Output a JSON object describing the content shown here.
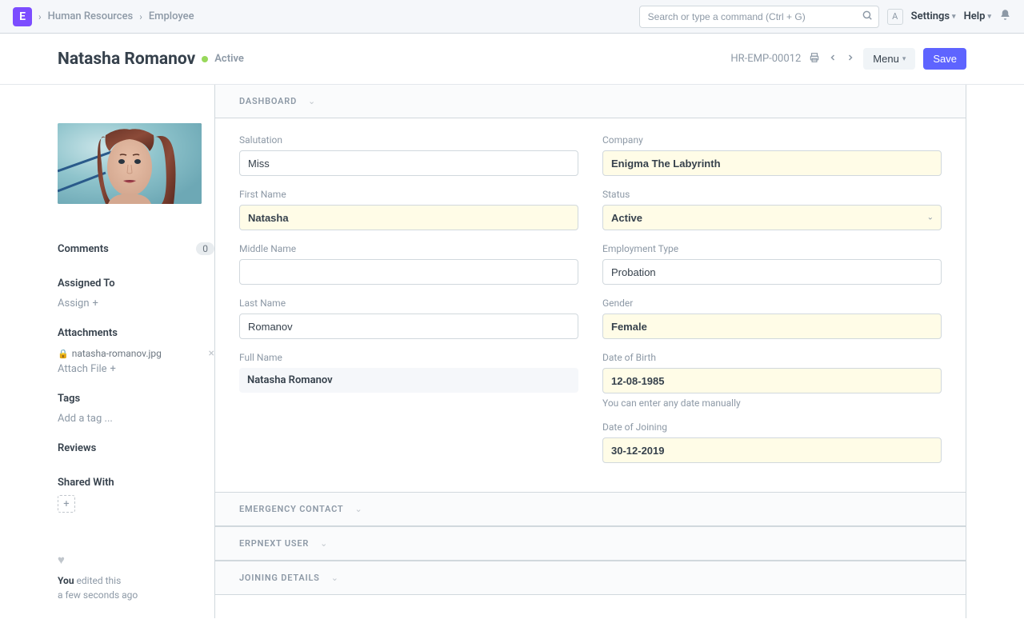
{
  "navbar": {
    "logo": "E",
    "breadcrumbs": [
      {
        "label": "Human Resources"
      },
      {
        "label": "Employee"
      }
    ],
    "search_placeholder": "Search or type a command (Ctrl + G)",
    "user_initial": "A",
    "settings": "Settings",
    "help": "Help"
  },
  "page": {
    "title": "Natasha Romanov",
    "status": "Active",
    "doc_id": "HR-EMP-00012",
    "menu_label": "Menu",
    "save_label": "Save"
  },
  "sidebar": {
    "comments_label": "Comments",
    "comments_count": "0",
    "assigned_to_label": "Assigned To",
    "assign_action": "Assign",
    "attachments_label": "Attachments",
    "attachment_file": "natasha-romanov.jpg",
    "attach_file_action": "Attach File",
    "tags_label": "Tags",
    "add_tag_action": "Add a tag ...",
    "reviews_label": "Reviews",
    "shared_with_label": "Shared With",
    "footer_strong": "You ",
    "footer_text1": "edited this",
    "footer_text2": "a few seconds ago"
  },
  "sections": {
    "dashboard": "DASHBOARD",
    "emergency_contact": "EMERGENCY CONTACT",
    "erpnext_user": "ERPNEXT USER",
    "joining_details": "JOINING DETAILS"
  },
  "form": {
    "left": {
      "salutation_label": "Salutation",
      "salutation": "Miss",
      "first_name_label": "First Name",
      "first_name": "Natasha",
      "middle_name_label": "Middle Name",
      "middle_name": "",
      "last_name_label": "Last Name",
      "last_name": "Romanov",
      "full_name_label": "Full Name",
      "full_name": "Natasha Romanov"
    },
    "right": {
      "company_label": "Company",
      "company": "Enigma The Labyrinth",
      "status_label": "Status",
      "status": "Active",
      "employment_type_label": "Employment Type",
      "employment_type": "Probation",
      "gender_label": "Gender",
      "gender": "Female",
      "dob_label": "Date of Birth",
      "dob": "12-08-1985",
      "dob_help": "You can enter any date manually",
      "doj_label": "Date of Joining",
      "doj": "30-12-2019"
    }
  }
}
